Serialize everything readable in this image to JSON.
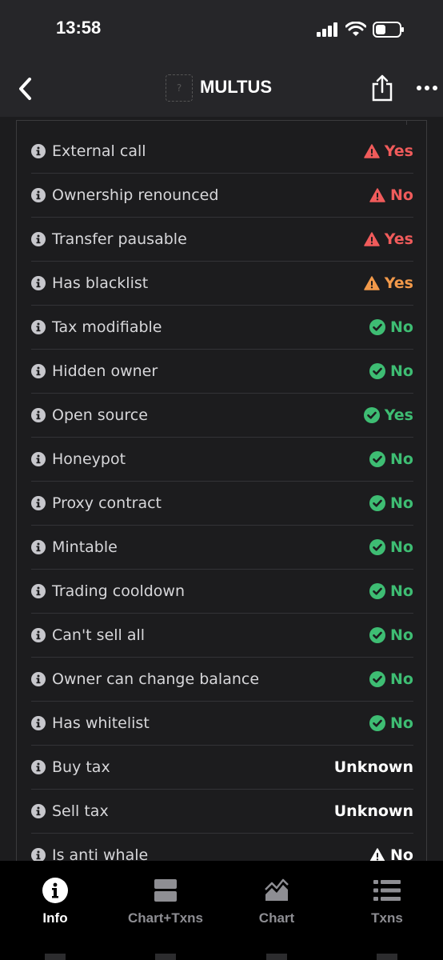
{
  "status_bar": {
    "time": "13:58"
  },
  "header": {
    "title": "MULTUS",
    "logo_placeholder": "?"
  },
  "rows": [
    {
      "label": "External call",
      "value": "Yes",
      "status": "danger"
    },
    {
      "label": "Ownership renounced",
      "value": "No",
      "status": "danger"
    },
    {
      "label": "Transfer pausable",
      "value": "Yes",
      "status": "danger"
    },
    {
      "label": "Has blacklist",
      "value": "Yes",
      "status": "warning"
    },
    {
      "label": "Tax modifiable",
      "value": "No",
      "status": "ok"
    },
    {
      "label": "Hidden owner",
      "value": "No",
      "status": "ok"
    },
    {
      "label": "Open source",
      "value": "Yes",
      "status": "ok"
    },
    {
      "label": "Honeypot",
      "value": "No",
      "status": "ok"
    },
    {
      "label": "Proxy contract",
      "value": "No",
      "status": "ok"
    },
    {
      "label": "Mintable",
      "value": "No",
      "status": "ok"
    },
    {
      "label": "Trading cooldown",
      "value": "No",
      "status": "ok"
    },
    {
      "label": "Can't sell all",
      "value": "No",
      "status": "ok"
    },
    {
      "label": "Owner can change balance",
      "value": "No",
      "status": "ok"
    },
    {
      "label": "Has whitelist",
      "value": "No",
      "status": "ok"
    },
    {
      "label": "Buy tax",
      "value": "Unknown",
      "status": "neutral"
    },
    {
      "label": "Sell tax",
      "value": "Unknown",
      "status": "neutral"
    },
    {
      "label": "Is anti whale",
      "value": "No",
      "status": "neutral-warning"
    }
  ],
  "tabs": [
    {
      "label": "Info",
      "icon": "info-icon",
      "active": true
    },
    {
      "label": "Chart+Txns",
      "icon": "split-view-icon",
      "active": false
    },
    {
      "label": "Chart",
      "icon": "chart-icon",
      "active": false
    },
    {
      "label": "Txns",
      "icon": "list-icon",
      "active": false
    }
  ],
  "colors": {
    "danger": "#f05b5b",
    "warning": "#f2994a",
    "ok": "#3ebd73",
    "neutral": "#ffffff",
    "background": "#1c1c1e",
    "header": "#262629"
  }
}
